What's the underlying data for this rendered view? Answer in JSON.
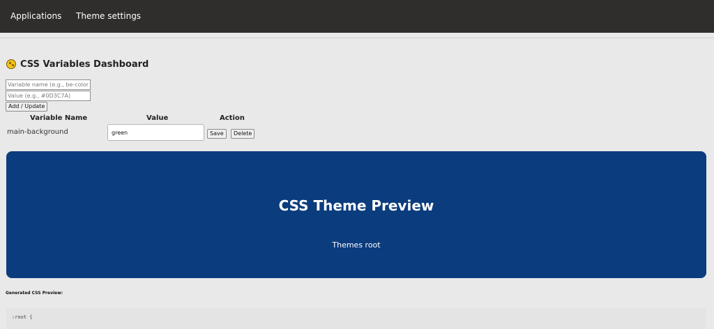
{
  "nav": {
    "items": [
      {
        "label": "Applications"
      },
      {
        "label": "Theme settings"
      }
    ]
  },
  "dashboard": {
    "title": "CSS Variables Dashboard",
    "icon": "palette-icon"
  },
  "form": {
    "name_placeholder": "Variable name (e.g., be-color)",
    "value_placeholder": "Value (e.g., #0D3C7A)",
    "submit_label": "Add / Update"
  },
  "table": {
    "headers": [
      "Variable Name",
      "Value",
      "Action"
    ],
    "rows": [
      {
        "name": "main-background",
        "value": "green",
        "save_label": "Save",
        "delete_label": "Delete"
      }
    ]
  },
  "preview": {
    "title": "CSS Theme Preview",
    "subtitle": "Themes root",
    "background": "#0b3c7e"
  },
  "generated": {
    "label": "Generated CSS Preview:",
    "code_first_line": ":root {"
  },
  "colors": {
    "topbar": "#2f2e2d",
    "page_bg": "#e9e9e9",
    "preview_bg": "#0b3c7e"
  }
}
